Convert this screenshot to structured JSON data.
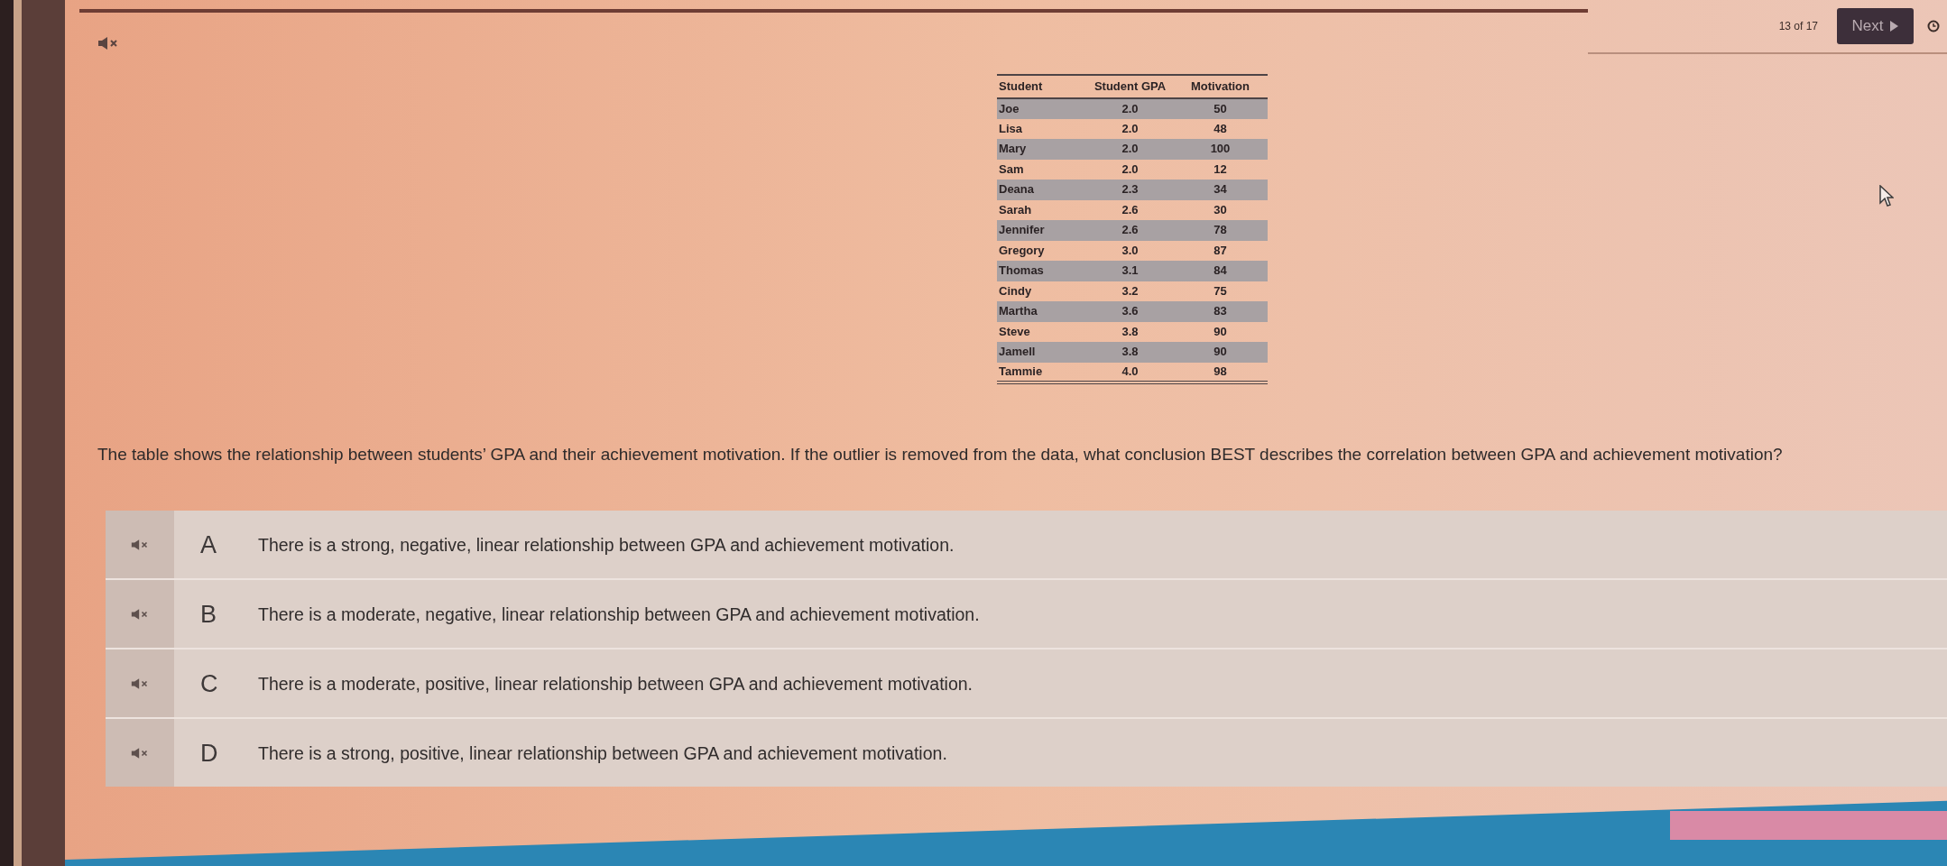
{
  "header": {
    "progress": "13 of 17",
    "next_button": "Next"
  },
  "table": {
    "columns": [
      "Student",
      "Student GPA",
      "Motivation"
    ],
    "rows": [
      [
        "Joe",
        "2.0",
        "50"
      ],
      [
        "Lisa",
        "2.0",
        "48"
      ],
      [
        "Mary",
        "2.0",
        "100"
      ],
      [
        "Sam",
        "2.0",
        "12"
      ],
      [
        "Deana",
        "2.3",
        "34"
      ],
      [
        "Sarah",
        "2.6",
        "30"
      ],
      [
        "Jennifer",
        "2.6",
        "78"
      ],
      [
        "Gregory",
        "3.0",
        "87"
      ],
      [
        "Thomas",
        "3.1",
        "84"
      ],
      [
        "Cindy",
        "3.2",
        "75"
      ],
      [
        "Martha",
        "3.6",
        "83"
      ],
      [
        "Steve",
        "3.8",
        "90"
      ],
      [
        "Jamell",
        "3.8",
        "90"
      ],
      [
        "Tammie",
        "4.0",
        "98"
      ]
    ]
  },
  "question": "The table shows the relationship between students’ GPA and their achievement motivation. If the outlier is removed from the data, what conclusion BEST describes the correlation between GPA and achievement motivation?",
  "options": [
    {
      "letter": "A",
      "text": "There is a strong, negative, linear relationship between GPA and achievement motivation.",
      "selected": false
    },
    {
      "letter": "B",
      "text": "There is a moderate, negative, linear relationship between GPA and achievement motivation.",
      "selected": false
    },
    {
      "letter": "C",
      "text": "There is a moderate, positive, linear relationship between GPA and achievement motivation.",
      "selected": false
    },
    {
      "letter": "D",
      "text": "There is a strong, positive, linear relationship between GPA and achievement motivation.",
      "selected": false
    }
  ]
}
